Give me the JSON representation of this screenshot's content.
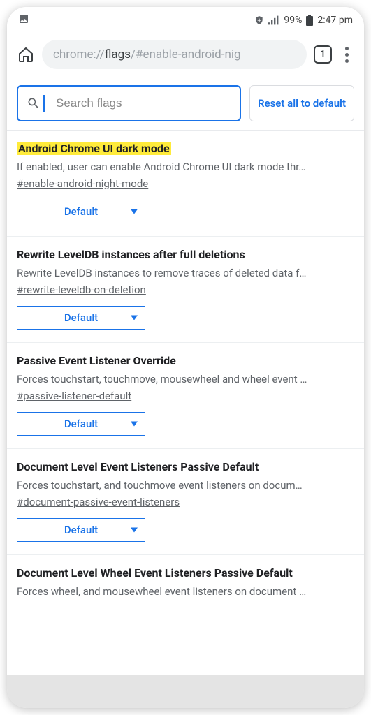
{
  "statusbar": {
    "battery_pct": "99%",
    "time": "2:47 pm"
  },
  "toolbar": {
    "url_scheme": "chrome://",
    "url_host": "flags",
    "url_path": "/#enable-android-nig",
    "tab_count": "1"
  },
  "search": {
    "placeholder": "Search flags",
    "reset_label": "Reset all to default"
  },
  "flags": [
    {
      "title": "Android Chrome UI dark mode",
      "highlighted": true,
      "description": "If enabled, user can enable Android Chrome UI dark mode thr…",
      "anchor": "#enable-android-night-mode",
      "value": "Default"
    },
    {
      "title": "Rewrite LevelDB instances after full deletions",
      "highlighted": false,
      "description": "Rewrite LevelDB instances to remove traces of deleted data f…",
      "anchor": "#rewrite-leveldb-on-deletion",
      "value": "Default"
    },
    {
      "title": "Passive Event Listener Override",
      "highlighted": false,
      "description": "Forces touchstart, touchmove, mousewheel and wheel event …",
      "anchor": "#passive-listener-default",
      "value": "Default"
    },
    {
      "title": "Document Level Event Listeners Passive Default",
      "highlighted": false,
      "description": "Forces touchstart, and touchmove event listeners on docum…",
      "anchor": "#document-passive-event-listeners",
      "value": "Default"
    },
    {
      "title": "Document Level Wheel Event Listeners Passive Default",
      "highlighted": false,
      "description": "Forces wheel, and mousewheel event listeners on document …",
      "anchor": "",
      "value": ""
    }
  ]
}
